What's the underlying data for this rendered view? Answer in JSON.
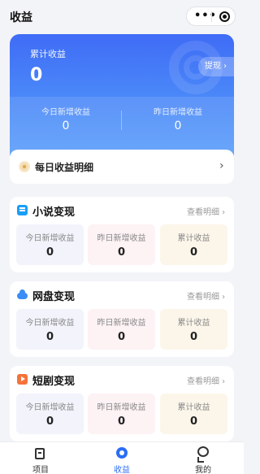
{
  "nav": {
    "title": "收益",
    "more_glyph": "•••"
  },
  "hero": {
    "label": "累计收益",
    "total": "0",
    "withdraw_label": "提现 ›",
    "today_label": "今日新增收益",
    "today_value": "0",
    "yesterday_label": "昨日新增收益",
    "yesterday_value": "0"
  },
  "daily": {
    "label": "每日收益明细",
    "arrow": "›"
  },
  "sections": [
    {
      "title": "小说变现",
      "link": "查看明细 ›",
      "icon": "book-icon",
      "cells": [
        {
          "label": "今日新增收益",
          "value": "0"
        },
        {
          "label": "昨日新增收益",
          "value": "0"
        },
        {
          "label": "累计收益",
          "value": "0"
        }
      ]
    },
    {
      "title": "网盘变现",
      "link": "查看明细 ›",
      "icon": "cloud-icon",
      "cells": [
        {
          "label": "今日新增收益",
          "value": "0"
        },
        {
          "label": "昨日新增收益",
          "value": "0"
        },
        {
          "label": "累计收益",
          "value": "0"
        }
      ]
    },
    {
      "title": "短剧变现",
      "link": "查看明细 ›",
      "icon": "play-icon",
      "cells": [
        {
          "label": "今日新增收益",
          "value": "0"
        },
        {
          "label": "昨日新增收益",
          "value": "0"
        },
        {
          "label": "累计收益",
          "value": "0"
        }
      ]
    }
  ],
  "tabbar": {
    "items": [
      {
        "label": "项目",
        "icon": "document-icon",
        "active": false
      },
      {
        "label": "收益",
        "icon": "coin-icon",
        "active": true
      },
      {
        "label": "我的",
        "icon": "user-icon",
        "active": false
      }
    ]
  },
  "colors": {
    "accent": "#2a6df5",
    "hero_top": "#3f6cf6",
    "hero_bottom": "#5aa0fb"
  }
}
